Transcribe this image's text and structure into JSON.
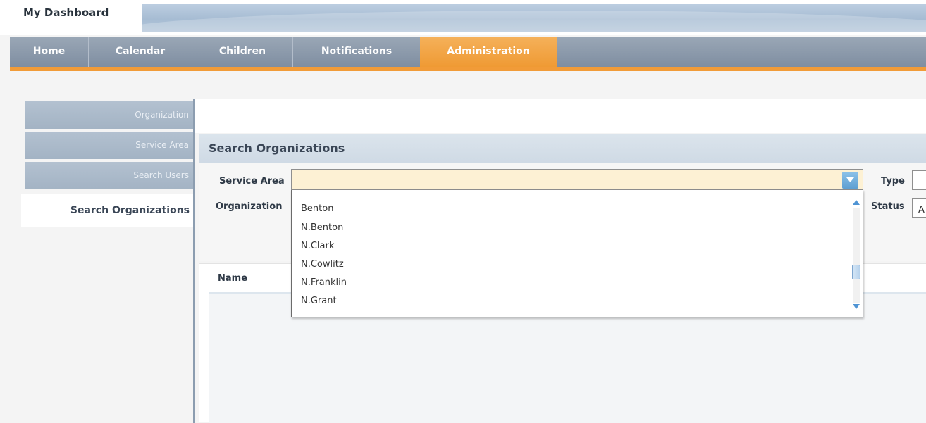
{
  "app": {
    "title": "My Dashboard"
  },
  "nav": {
    "tabs": [
      {
        "label": "Home"
      },
      {
        "label": "Calendar"
      },
      {
        "label": "Children"
      },
      {
        "label": "Notifications"
      },
      {
        "label": "Administration",
        "active": true
      }
    ]
  },
  "sidebar": {
    "items": [
      {
        "label": "Organization"
      },
      {
        "label": "Service Area"
      },
      {
        "label": "Search Users"
      },
      {
        "label": "Search Organizations",
        "active": true
      }
    ]
  },
  "search": {
    "title": "Search Organizations",
    "service_area_label": "Service Area",
    "service_area_value": "",
    "organization_label": "Organization",
    "type_label": "Type",
    "status_label": "Status",
    "status_value": "A"
  },
  "dropdown": {
    "options": [
      "Benton",
      "N.Benton",
      "N.Clark",
      "N.Cowlitz",
      "N.Franklin",
      "N.Grant"
    ]
  },
  "grid": {
    "name_header": "Name"
  },
  "icons": {
    "dropdown_toggle": "chevron-down-icon",
    "scroll_up": "scroll-up-icon",
    "scroll_down": "scroll-down-icon"
  },
  "colors": {
    "accent_orange": "#ef9a34",
    "nav_gray": "#8a98aa",
    "sidebar_blue": "#a8b7c8",
    "input_highlight": "#fdf1d4"
  }
}
